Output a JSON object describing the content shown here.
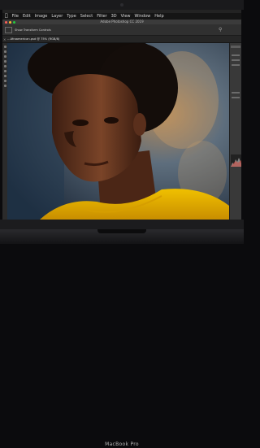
{
  "menubar": {
    "items": [
      "File",
      "Edit",
      "Image",
      "Layer",
      "Type",
      "Select",
      "Filter",
      "3D",
      "View",
      "Window",
      "Help"
    ]
  },
  "window": {
    "title": "Adobe Photoshop CC 2019"
  },
  "options_bar": {
    "label": "Show Transform Controls"
  },
  "document": {
    "tab_label": "…Afroamerican.psd @ 75% (RGB/8)"
  },
  "device": {
    "brand": "MacBook Pro"
  },
  "colors": {
    "shirt": "#e8b400",
    "skin": "#6b3a22",
    "background": "#1d2b3c"
  }
}
